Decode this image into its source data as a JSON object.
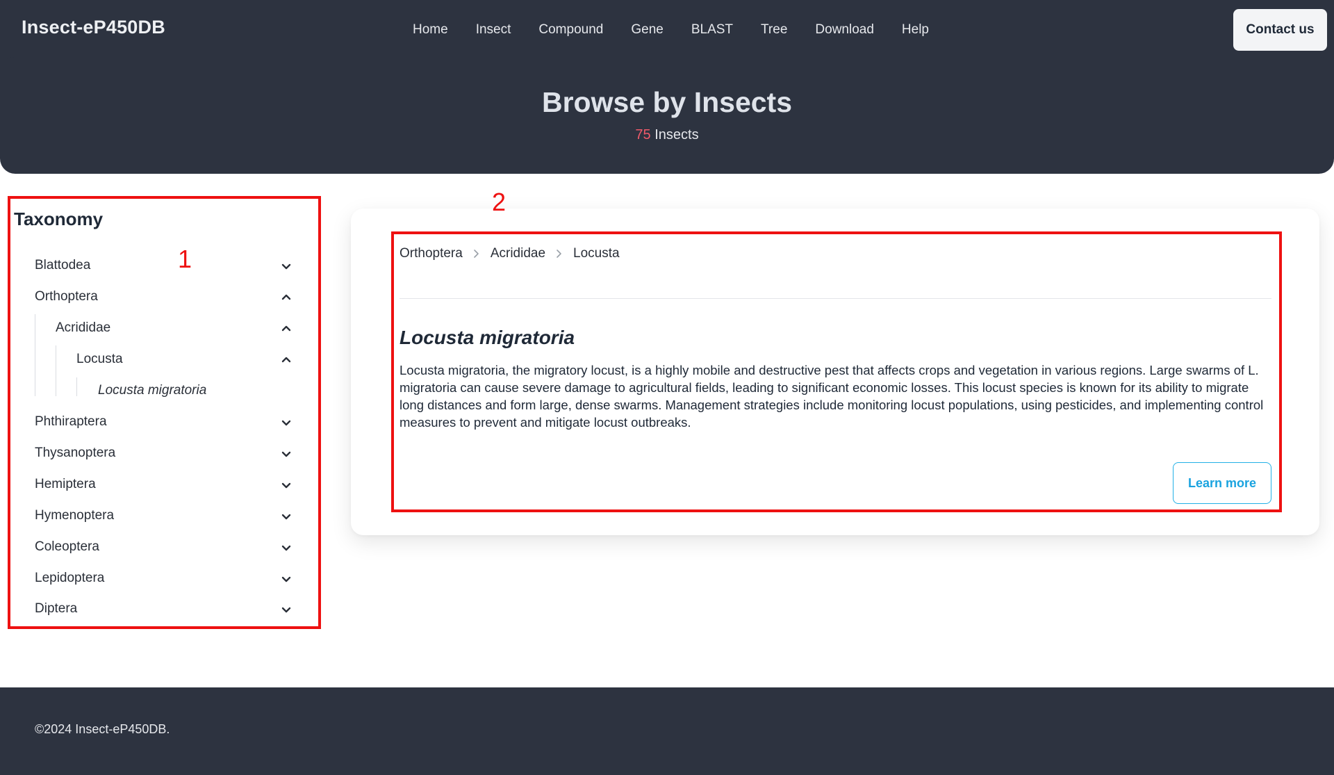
{
  "header": {
    "brand": "Insect-eP450DB",
    "nav": [
      "Home",
      "Insect",
      "Compound",
      "Gene",
      "BLAST",
      "Tree",
      "Download",
      "Help"
    ],
    "contact_label": "Contact us"
  },
  "hero": {
    "title": "Browse by Insects",
    "count": "75",
    "count_label": "Insects"
  },
  "annotations": {
    "box1": "1",
    "box2": "2"
  },
  "sidebar": {
    "title": "Taxonomy",
    "items": [
      {
        "label": "Blattodea",
        "icon": "chevron-down-icon"
      },
      {
        "label": "Orthoptera",
        "icon": "chevron-up-icon"
      },
      {
        "label": "Acrididae",
        "icon": "chevron-up-icon"
      },
      {
        "label": "Locusta",
        "icon": "chevron-up-icon"
      },
      {
        "label": "Locusta migratoria",
        "icon": ""
      },
      {
        "label": "Phthiraptera",
        "icon": "chevron-down-icon"
      },
      {
        "label": "Thysanoptera",
        "icon": "chevron-down-icon"
      },
      {
        "label": "Hemiptera",
        "icon": "chevron-down-icon"
      },
      {
        "label": "Hymenoptera",
        "icon": "chevron-down-icon"
      },
      {
        "label": "Coleoptera",
        "icon": "chevron-down-icon"
      },
      {
        "label": "Lepidoptera",
        "icon": "chevron-down-icon"
      },
      {
        "label": "Diptera",
        "icon": "chevron-down-icon"
      }
    ]
  },
  "detail": {
    "breadcrumb": [
      "Orthoptera",
      "Acrididae",
      "Locusta"
    ],
    "species": "Locusta migratoria",
    "description": "Locusta migratoria, the migratory locust, is a highly mobile and destructive pest that affects crops and vegetation in various regions. Large swarms of L. migratoria can cause severe damage to agricultural fields, leading to significant economic losses. This locust species is known for its ability to migrate long distances and form large, dense swarms. Management strategies include monitoring locust populations, using pesticides, and implementing control measures to prevent and mitigate locust outbreaks.",
    "learn_more": "Learn more"
  },
  "footer": {
    "copyright": "©2024 Insect-eP450DB."
  },
  "colors": {
    "dark_bg": "#2d3340",
    "count_accent": "#f05a6a",
    "link_accent": "#1aa3df",
    "annotation_red": "#ee1111"
  }
}
